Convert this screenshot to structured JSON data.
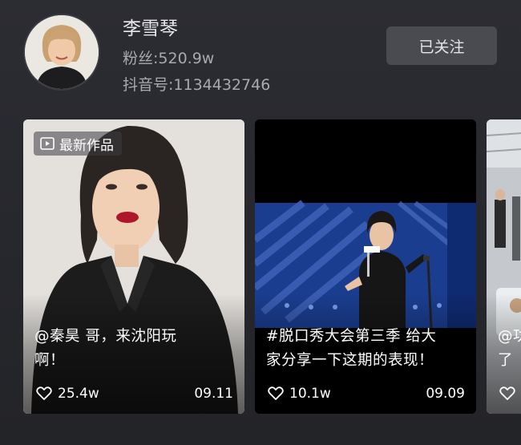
{
  "profile": {
    "name": "李雪琴",
    "fans": "粉丝:520.9w",
    "douyin_id": "抖音号:1134432746",
    "follow_label": "已关注"
  },
  "videos": [
    {
      "badge": "最新作品",
      "caption_line1": "@秦昊 哥，来沈阳玩",
      "caption_line2": "啊！",
      "likes": "25.4w",
      "date": "09.11"
    },
    {
      "caption_line1": "#脱口秀大会第三季 给大",
      "caption_line2": "家分享一下这期的表现！",
      "likes": "10.1w",
      "date": "09.09"
    },
    {
      "caption_line1": "@功",
      "caption_line2": "了"
    }
  ],
  "colors": {
    "background": "#2a2b30",
    "follow_button": "#4a4b51",
    "secondary_text": "#a9a9ae"
  },
  "icons": [
    "play-icon",
    "heart-icon"
  ]
}
